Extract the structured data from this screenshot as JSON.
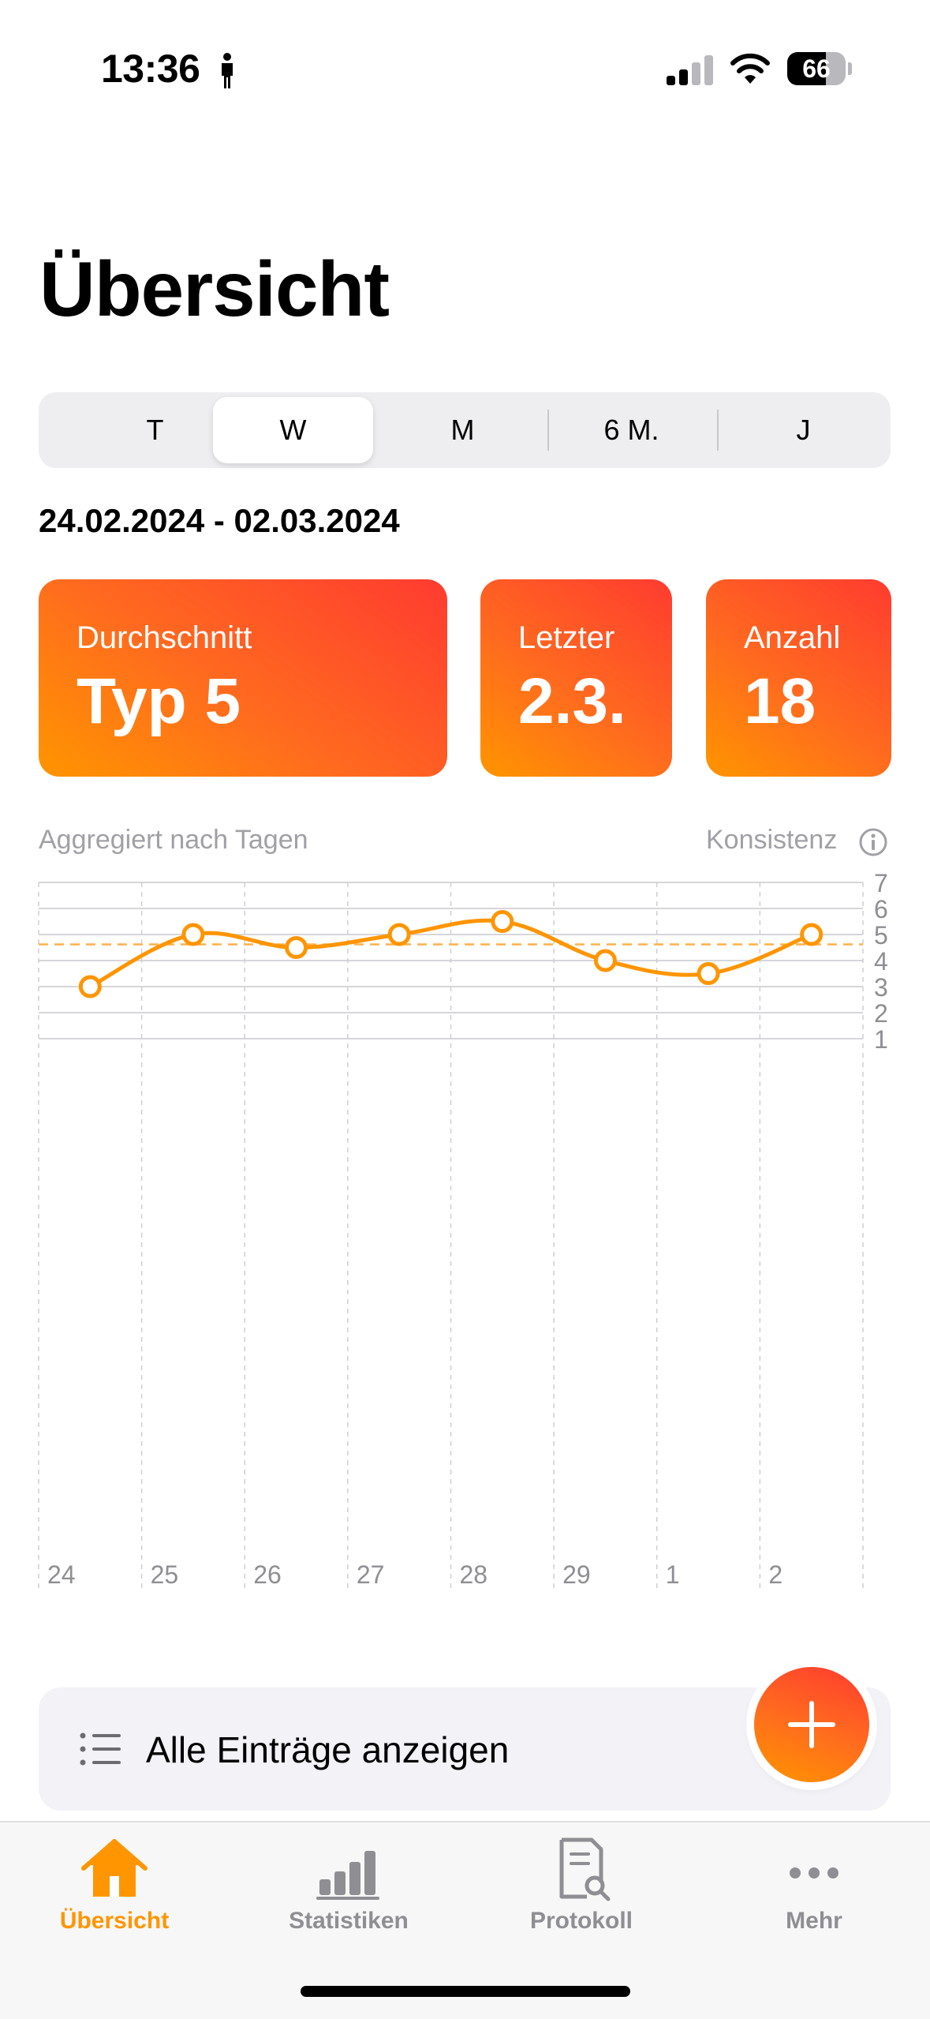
{
  "status_bar": {
    "time": "13:36",
    "battery": "66",
    "battery_level_percent": 66
  },
  "page": {
    "title": "Übersicht"
  },
  "segments": {
    "items": [
      {
        "label": "T",
        "active": false
      },
      {
        "label": "W",
        "active": true
      },
      {
        "label": "M",
        "active": false
      },
      {
        "label": "6 M.",
        "active": false
      },
      {
        "label": "J",
        "active": false
      }
    ]
  },
  "date_range": "24.02.2024 - 02.03.2024",
  "stats": [
    {
      "label": "Durchschnitt",
      "value": "Typ 5"
    },
    {
      "label": "Letzter",
      "value": "2.3."
    },
    {
      "label": "Anzahl",
      "value": "18"
    }
  ],
  "chart": {
    "subtitle": "Aggregiert nach Tagen",
    "consistency_label": "Konsistenz"
  },
  "chart_data": {
    "type": "line",
    "categories": [
      "24",
      "25",
      "26",
      "27",
      "28",
      "29",
      "1",
      "2"
    ],
    "series": [
      {
        "values": [
          3,
          5,
          4.5,
          5,
          5.5,
          4,
          3.5,
          5
        ]
      }
    ],
    "average": 4.62,
    "ylim": [
      0,
      7
    ],
    "y_ticks": [
      1,
      2,
      3,
      4,
      5,
      6,
      7
    ],
    "grid": true,
    "accent": "#ff9500"
  },
  "entries_button": {
    "label": "Alle Einträge anzeigen",
    "icon": "list-icon"
  },
  "fab": {
    "icon": "plus-icon"
  },
  "tabs": [
    {
      "label": "Übersicht",
      "icon": "home-icon",
      "active": true
    },
    {
      "label": "Statistiken",
      "icon": "bar-chart-icon",
      "active": false
    },
    {
      "label": "Protokoll",
      "icon": "document-search-icon",
      "active": false
    },
    {
      "label": "Mehr",
      "icon": "more-icon",
      "active": false
    }
  ],
  "colors": {
    "accent": "#ff9500",
    "accent_red": "#ff3b30",
    "inactive": "#8e8e93"
  }
}
